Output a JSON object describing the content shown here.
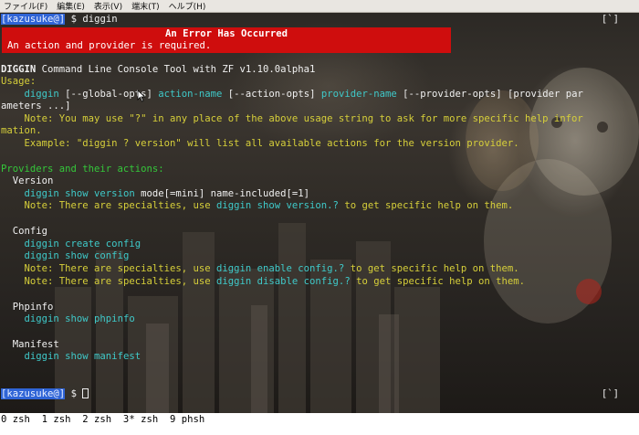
{
  "menubar": {
    "items": [
      "ファイル(F)",
      "編集(E)",
      "表示(V)",
      "端末(T)",
      "ヘルプ(H)"
    ]
  },
  "terminal": {
    "top_prompt": {
      "tag": "[kazusuke@]",
      "symbol": "$",
      "command": "diggin"
    },
    "top_indicator": "[`]",
    "error": {
      "title": "An Error Has Occurred",
      "message": "An action and provider is required."
    },
    "header_bold": "DIGGIN",
    "header_rest": " Command Line Console Tool with ZF v1.10.0alpha1",
    "usage_label": "Usage:",
    "usage": {
      "cmd": "diggin",
      "global_opts": " [--global-opts] ",
      "action_name": "action-name",
      "action_opts": " [--action-opts] ",
      "provider_name": "provider-name",
      "provider_opts": " [--provider-opts] [provider par",
      "cont": "ameters ...]"
    },
    "note_line1": "    Note: You may use \"?\" in any place of the above usage string to ask for more specific help infor",
    "note_line2": "mation.",
    "example_line": "    Example: \"diggin ? version\" will list all available actions for the version provider.",
    "providers_label": "Providers and their actions:",
    "providers": {
      "version": {
        "name": "Version",
        "cmd_cyan": "diggin show version",
        "cmd_rest": " mode[=mini] name-included[=1]",
        "note_pre": "Note: There are specialties, use ",
        "note_cmd": "diggin show version.?",
        "note_post": " to get specific help on them."
      },
      "config": {
        "name": "Config",
        "cmd1": "diggin create config",
        "cmd2": "diggin show config",
        "note1_pre": "Note: There are specialties, use ",
        "note1_cmd": "diggin enable config.?",
        "note1_post": " to get specific help on them.",
        "note2_pre": "Note: There are specialties, use ",
        "note2_cmd": "diggin disable config.?",
        "note2_post": " to get specific help on them."
      },
      "phpinfo": {
        "name": "Phpinfo",
        "cmd": "diggin show phpinfo"
      },
      "manifest": {
        "name": "Manifest",
        "cmd": "diggin show manifest"
      }
    },
    "bottom_prompt": {
      "tag": "[kazusuke@]",
      "symbol": "$"
    },
    "bottom_indicator": "[`]"
  },
  "statusbar": {
    "text": "0 zsh  1 zsh  2 zsh  3* zsh  9 phsh"
  },
  "colors": {
    "error_bg": "#cf0d0d",
    "prompt_tag_bg": "#2f64d6",
    "yellow_text": "#d6cf3a",
    "green_text": "#34c73a",
    "cyan_text": "#3fc9c9"
  }
}
